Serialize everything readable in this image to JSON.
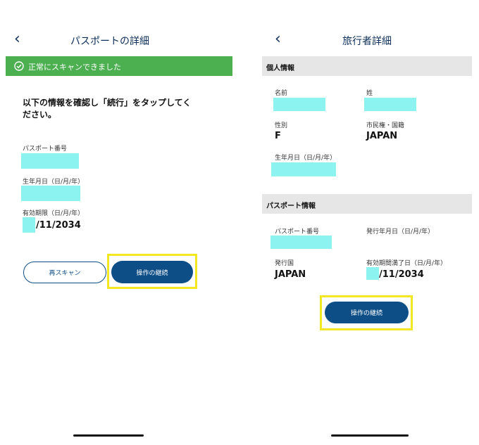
{
  "left": {
    "title": "パスポートの詳細",
    "back_icon": "chevron-left-icon",
    "banner": {
      "text": "正常にスキャンできました",
      "icon": "check-circle-icon",
      "color": "#4caf50"
    },
    "instruction": "以下の情報を確認し「続行」をタップしてください。",
    "fields": {
      "passport_number_label": "パスポート番号",
      "birth_date_label": "生年月日（日/月/年）",
      "expiry_label": "有効期限（日/月/年）",
      "expiry_value": "/11/2034"
    },
    "rescan_label": "再スキャン",
    "continue_label": "操作の継続"
  },
  "right": {
    "title": "旅行者詳細",
    "back_icon": "chevron-left-icon",
    "personal_section": "個人情報",
    "given_name_label": "名前",
    "surname_label": "姓",
    "sex_label": "性別",
    "sex_value": "F",
    "citizenship_label": "市民権・国籍",
    "citizenship_value": "JAPAN",
    "birth_date_label": "生年月日（日/月/年）",
    "passport_section": "パスポート情報",
    "passport_number_label": "パスポート番号",
    "issue_date_label": "発行年月日（日/月/年）",
    "issuing_country_label": "発行国",
    "issuing_country_value": "JAPAN",
    "expiry_label": "有効期間満了日（日/月/年）",
    "expiry_value": "/11/2034",
    "continue_label": "操作の継続"
  },
  "colors": {
    "accent": "#0d4e86",
    "highlight": "#f1e823",
    "redaction": "#8cf3f0",
    "success": "#4caf50"
  }
}
